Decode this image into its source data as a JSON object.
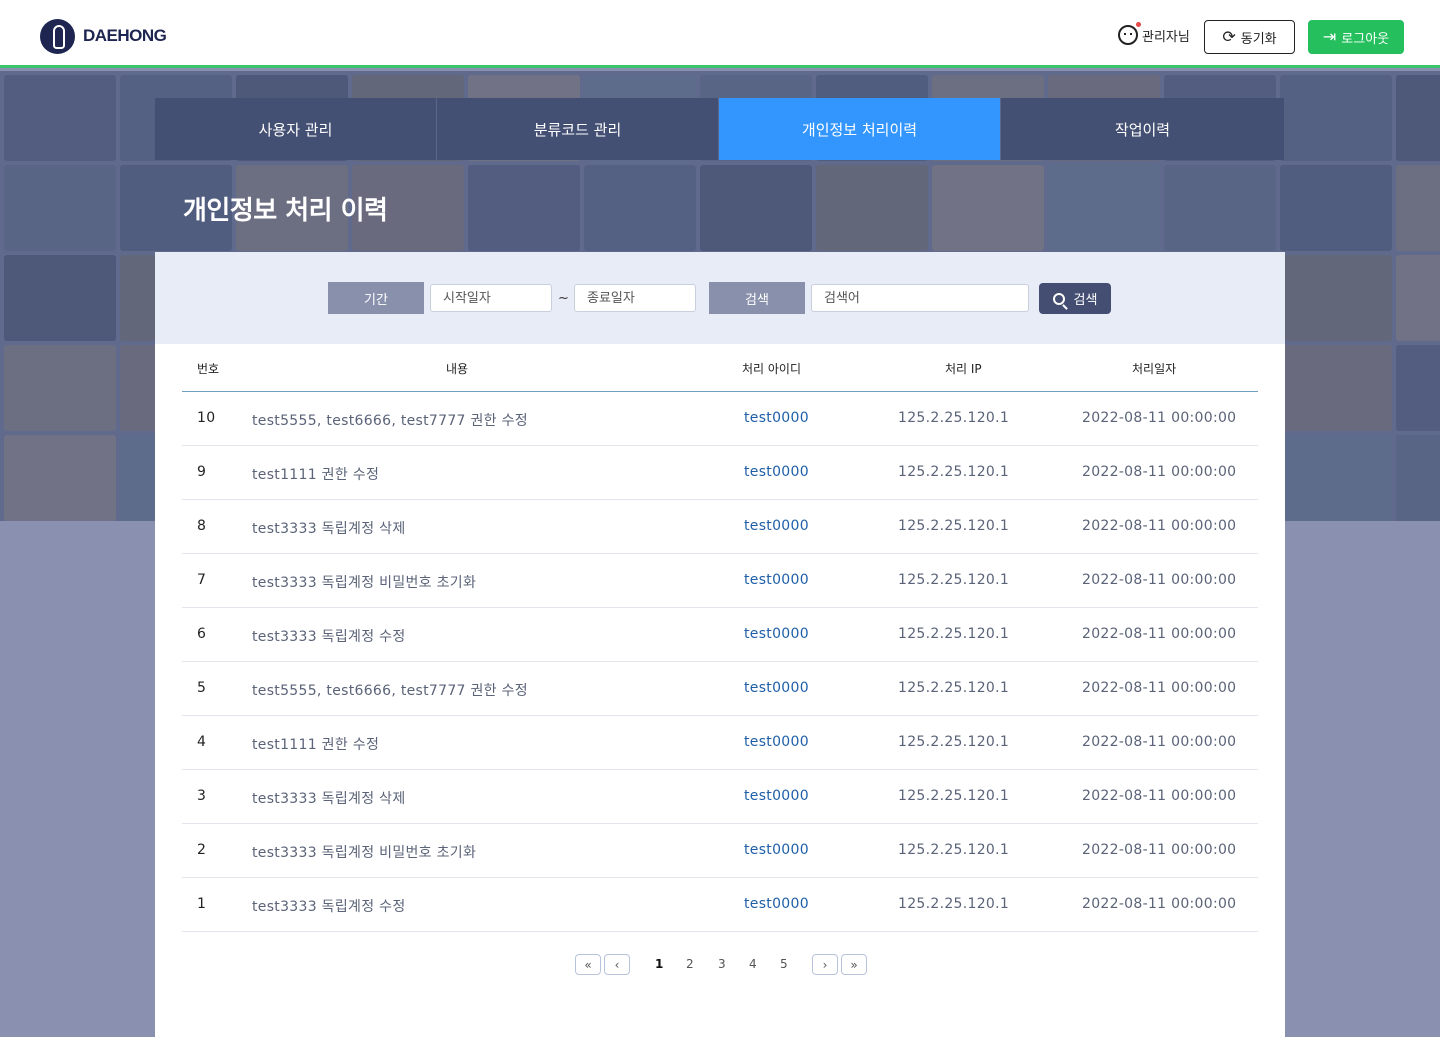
{
  "header": {
    "logo_text": "DAEHONG",
    "user_label": "관리자님",
    "sync_label": "동기화",
    "logout_label": "로그아웃"
  },
  "tabs": [
    {
      "label": "사용자 관리",
      "active": false
    },
    {
      "label": "분류코드 관리",
      "active": false
    },
    {
      "label": "개인정보 처리이력",
      "active": true
    },
    {
      "label": "작업이력",
      "active": false
    }
  ],
  "page_title": "개인정보 처리 이력",
  "filter": {
    "period_label": "기간",
    "start_placeholder": "시작일자",
    "separator": "~",
    "end_placeholder": "종료일자",
    "search_label": "검색",
    "keyword_placeholder": "검색어",
    "search_button": "검색"
  },
  "table": {
    "columns": [
      "번호",
      "내용",
      "처리 아이디",
      "처리 IP",
      "처리일자"
    ],
    "rows": [
      {
        "no": "10",
        "content": "test5555, test6666, test7777 권한 수정",
        "id": "test0000",
        "ip": "125.2.25.120.1",
        "date": "2022-08-11 00:00:00"
      },
      {
        "no": "9",
        "content": "test1111 권한 수정",
        "id": "test0000",
        "ip": "125.2.25.120.1",
        "date": "2022-08-11 00:00:00"
      },
      {
        "no": "8",
        "content": "test3333 독립계정 삭제",
        "id": "test0000",
        "ip": "125.2.25.120.1",
        "date": "2022-08-11 00:00:00"
      },
      {
        "no": "7",
        "content": "test3333 독립계정 비밀번호 초기화",
        "id": "test0000",
        "ip": "125.2.25.120.1",
        "date": "2022-08-11 00:00:00"
      },
      {
        "no": "6",
        "content": "test3333 독립계정 수정",
        "id": "test0000",
        "ip": "125.2.25.120.1",
        "date": "2022-08-11 00:00:00"
      },
      {
        "no": "5",
        "content": "test5555, test6666, test7777 권한 수정",
        "id": "test0000",
        "ip": "125.2.25.120.1",
        "date": "2022-08-11 00:00:00"
      },
      {
        "no": "4",
        "content": "test1111 권한 수정",
        "id": "test0000",
        "ip": "125.2.25.120.1",
        "date": "2022-08-11 00:00:00"
      },
      {
        "no": "3",
        "content": "test3333 독립계정 삭제",
        "id": "test0000",
        "ip": "125.2.25.120.1",
        "date": "2022-08-11 00:00:00"
      },
      {
        "no": "2",
        "content": "test3333 독립계정 비밀번호 초기화",
        "id": "test0000",
        "ip": "125.2.25.120.1",
        "date": "2022-08-11 00:00:00"
      },
      {
        "no": "1",
        "content": "test3333 독립계정 수정",
        "id": "test0000",
        "ip": "125.2.25.120.1",
        "date": "2022-08-11 00:00:00"
      }
    ]
  },
  "pagination": {
    "first": "«",
    "prev": "‹",
    "pages": [
      "1",
      "2",
      "3",
      "4",
      "5"
    ],
    "current": "1",
    "next": "›",
    "last": "»"
  },
  "colors": {
    "brand_green": "#25c05d",
    "tab_active": "#3396ff",
    "tab_default": "#445073",
    "link_blue": "#1f5fa8"
  },
  "icons": {
    "logo": "daehong-logo-icon",
    "user": "user-face-icon",
    "sync": "sync-icon",
    "logout": "logout-icon",
    "search": "search-icon"
  }
}
